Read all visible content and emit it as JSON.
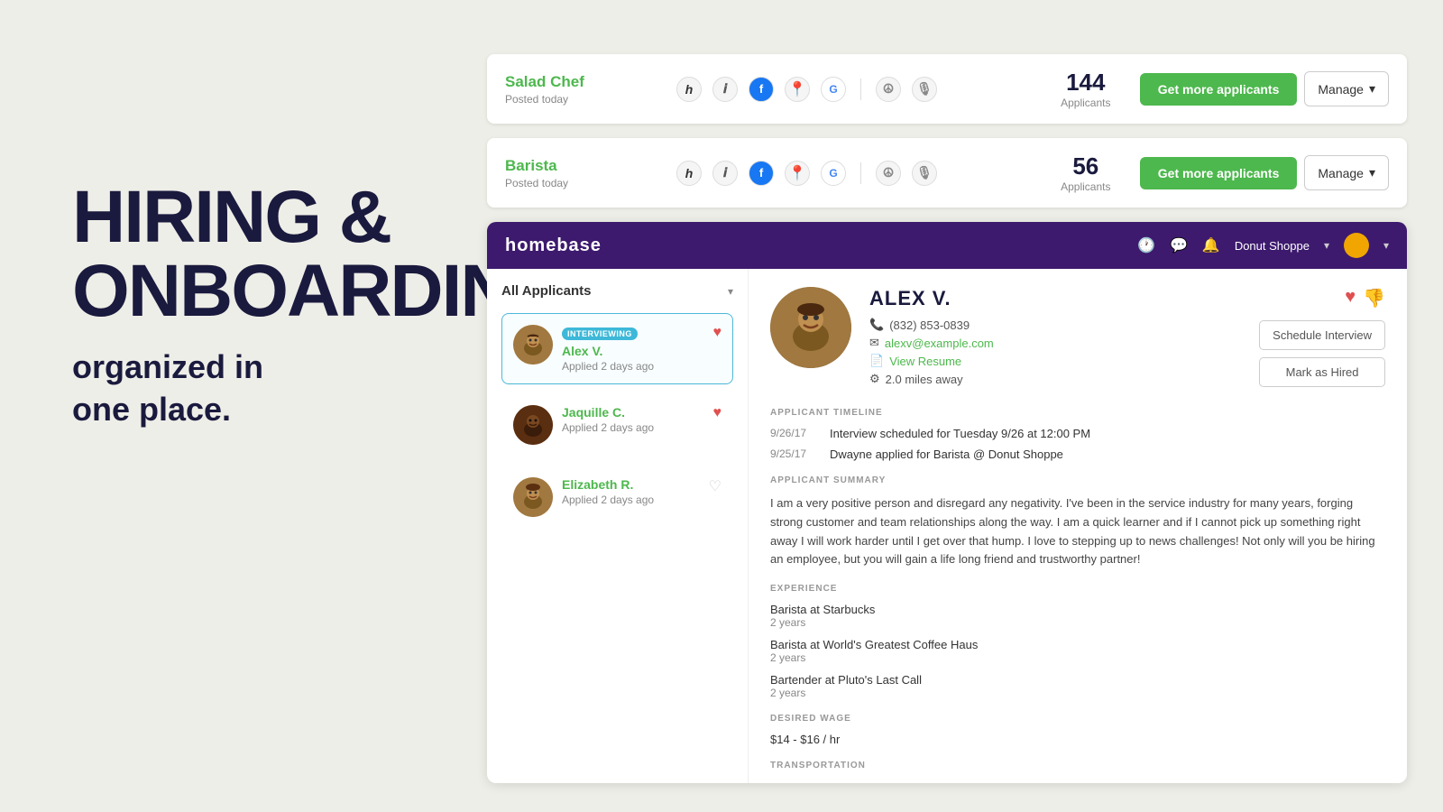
{
  "hero": {
    "title": "HIRING &\nONBOARDING",
    "subtitle": "organized in\none place."
  },
  "job_cards": [
    {
      "title": "Salad Chef",
      "posted": "Posted today",
      "applicants_count": "144",
      "applicants_label": "Applicants",
      "btn_get_more": "Get more applicants",
      "btn_manage": "Manage"
    },
    {
      "title": "Barista",
      "posted": "Posted today",
      "applicants_count": "56",
      "applicants_label": "Applicants",
      "btn_get_more": "Get more applicants",
      "btn_manage": "Manage"
    }
  ],
  "homebase": {
    "logo": "homebase",
    "store_name": "Donut Shoppe",
    "panel_title": "All Applicants"
  },
  "applicants": [
    {
      "name": "Alex V.",
      "applied": "Applied 2 days ago",
      "status": "INTERVIEWING",
      "favorited": true,
      "active": true
    },
    {
      "name": "Jaquille C.",
      "applied": "Applied 2 days ago",
      "status": "",
      "favorited": true,
      "active": false
    },
    {
      "name": "Elizabeth R.",
      "applied": "Applied 2 days ago",
      "status": "",
      "favorited": false,
      "active": false
    }
  ],
  "detail": {
    "name": "ALEX V.",
    "phone": "(832) 853-0839",
    "email": "alexv@example.com",
    "resume_link": "View Resume",
    "distance": "2.0 miles away",
    "btn_schedule": "Schedule Interview",
    "btn_mark_hired": "Mark as Hired",
    "timeline_label": "APPLICANT TIMELINE",
    "timeline": [
      {
        "date": "9/26/17",
        "text": "Interview scheduled for Tuesday 9/26 at 12:00 PM"
      },
      {
        "date": "9/25/17",
        "text": "Dwayne applied for Barista @ Donut Shoppe"
      }
    ],
    "summary_label": "APPLICANT SUMMARY",
    "summary": "I am a very positive person and disregard any negativity. I've been in the service industry for many years, forging strong customer and team relationships along the way. I am a quick learner and if I cannot pick up something right away I will work harder until I get over that hump. I love to stepping up to news challenges! Not only will you be hiring an employee, but you will gain a life long friend and trustworthy partner!",
    "experience_label": "EXPERIENCE",
    "experience": [
      {
        "title": "Barista at Starbucks",
        "duration": "2 years"
      },
      {
        "title": "Barista at World's Greatest Coffee Haus",
        "duration": "2 years"
      },
      {
        "title": "Bartender at Pluto's Last Call",
        "duration": "2 years"
      }
    ],
    "wage_label": "DESIRED WAGE",
    "wage": "$14 - $16 / hr",
    "transportation_label": "TRANSPORTATION"
  }
}
